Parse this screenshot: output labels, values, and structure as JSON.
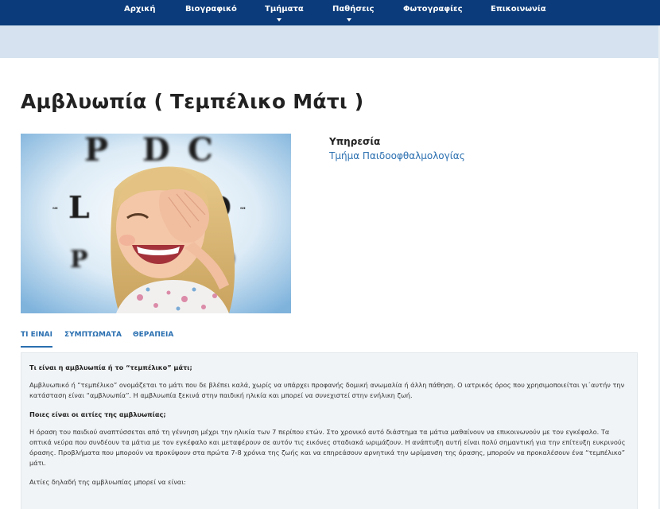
{
  "nav": {
    "items": [
      {
        "label": "Αρχική",
        "dropdown": false
      },
      {
        "label": "Βιογραφικό",
        "dropdown": false
      },
      {
        "label": "Τμήματα",
        "dropdown": true
      },
      {
        "label": "Παθήσεις",
        "dropdown": true
      },
      {
        "label": "Φωτογραφίες",
        "dropdown": false
      },
      {
        "label": "Επικοινωνία",
        "dropdown": false
      }
    ]
  },
  "page": {
    "title": "Αμβλυωπία ( Τεμπέλικο Μάτι )"
  },
  "hero": {
    "chart_letters": [
      "P",
      "D",
      "C",
      "L",
      "D",
      "P",
      "D"
    ],
    "small_text_left": "SH",
    "small_text_right": "SH"
  },
  "service": {
    "label": "Υπηρεσία",
    "link": "Τμήμα Παιδοοφθαλμολογίας"
  },
  "tabs": [
    "ΤΙ ΕΙΝΑΙ",
    "ΣΥΜΠΤΩΜΑΤΑ",
    "ΘΕΡΑΠΕΙΑ"
  ],
  "content": {
    "q1": "Τι είναι η αμβλυωπία ή το “τεμπέλικο” μάτι;",
    "p1": "Αμβλυωπικό ή “τεμπέλικο” ονομάζεται το μάτι που δε βλέπει καλά, χωρίς να υπάρχει προφανής δομική ανωμαλία ή άλλη πάθηση. Ο ιατρικός όρος που χρησιμοποιείται γι΄αυτήν την κατάσταση είναι “αμβλυωπία”. Η αμβλυωπία ξεκινά στην παιδική ηλικία και μπορεί να συνεχιστεί στην ενήλικη ζωή.",
    "q2": "Ποιες είναι οι αιτίες της αμβλυωπίας;",
    "p2": "Η όραση του παιδιού αναπτύσσεται από τη γέννηση μέχρι την ηλικία των 7 περίπου ετών.  Στο χρονικό αυτό διάστημα τα μάτια μαθαίνουν να επικοινωνούν με τον εγκέφαλο. Τα οπτικά νεύρα που συνδέουν τα μάτια με τον εγκέφαλο και μεταφέρουν σε αυτόν τις εικόνες σταδιακά ωριμάζουν. Η ανάπτυξη αυτή είναι πολύ σημαντική για την επίτευξη ευκρινούς όρασης. Προβλήματα που μπορούν να προκύψουν στα πρώτα 7-8 χρόνια της ζωής και να επηρεάσουν αρνητικά την ωρίμανση της όρασης, μπορούν να προκαλέσουν ένα “τεμπέλικο” μάτι.",
    "p3": "Αιτίες δηλαδή της αμβλυωπίας μπορεί να είναι:"
  }
}
